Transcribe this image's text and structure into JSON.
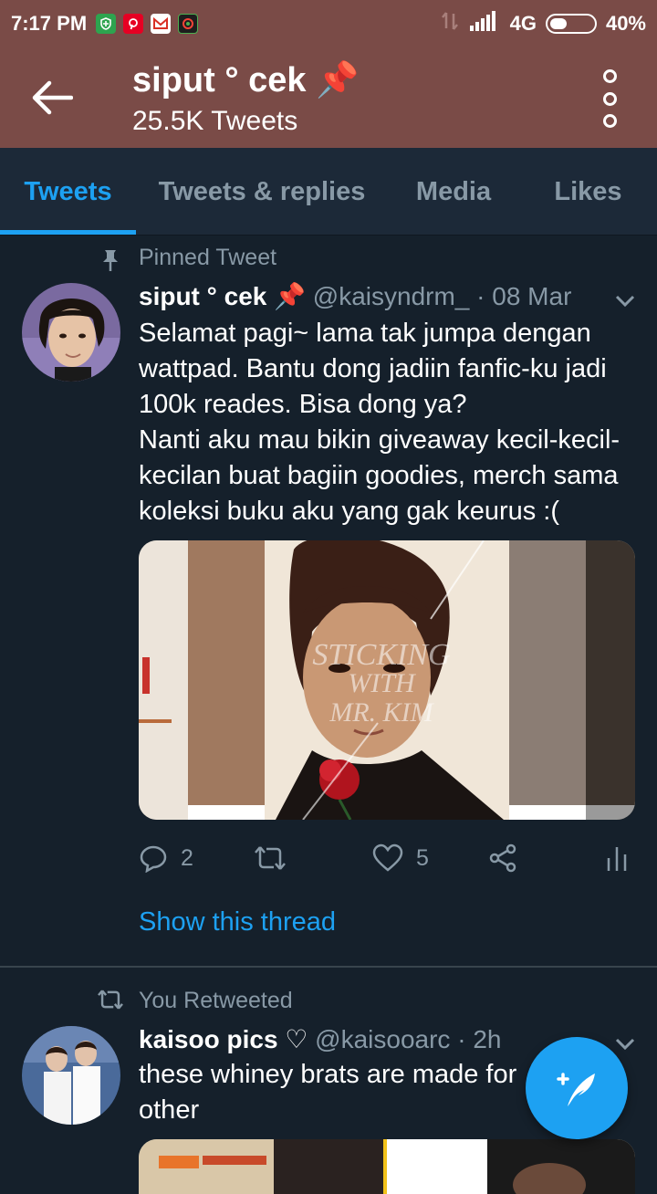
{
  "status_bar": {
    "time": "7:17 PM",
    "network": "4G",
    "battery_percent": "40%",
    "battery_level": 0.4,
    "notification_icons": [
      "shield-icon",
      "pinterest-icon",
      "gmail-icon",
      "app-icon"
    ]
  },
  "app_bar": {
    "title": "siput ° cek 📌",
    "subtitle": "25.5K Tweets"
  },
  "tabs": [
    {
      "label": "Tweets",
      "active": true
    },
    {
      "label": "Tweets & replies",
      "active": false
    },
    {
      "label": "Media",
      "active": false
    },
    {
      "label": "Likes",
      "active": false
    }
  ],
  "tweets": [
    {
      "context": "Pinned Tweet",
      "display_name": "siput ° cek 📌",
      "handle_time": "@kaisyndrm_ · 08 Mar",
      "body": [
        "Selamat pagi~ lama tak jumpa dengan",
        "wattpad. Bantu dong jadiin fanfic-ku jadi",
        "100k reades. Bisa dong ya?",
        "Nanti aku mau bikin giveaway kecil-kecil-",
        "kecilan buat bagiin goodies, merch sama",
        "koleksi buku aku yang gak keurus :("
      ],
      "media_overlay_lines": [
        "STICKING",
        "WITH",
        "MR. KIM"
      ],
      "reply_count": "2",
      "like_count": "5",
      "thread_link": "Show this thread"
    },
    {
      "context": "You Retweeted",
      "display_name": "kaisoo pics ♡",
      "handle_time": "@kaisooarc · 2h",
      "body": [
        "these whiney brats are made for",
        "other"
      ]
    }
  ],
  "colors": {
    "header_bg": "#7a4b47",
    "page_bg": "#15202b",
    "tabbar_bg": "#1c2938",
    "accent": "#1da1f2",
    "muted": "#8899a6",
    "divider": "#38444d"
  }
}
